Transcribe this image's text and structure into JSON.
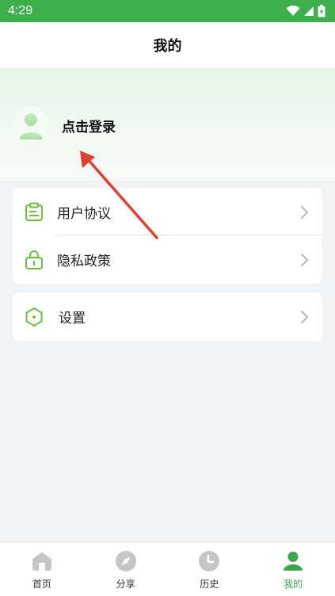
{
  "status_bar": {
    "time": "4:29"
  },
  "header": {
    "title": "我的"
  },
  "profile": {
    "login_label": "点击登录"
  },
  "menu_group_1": [
    {
      "label": "用户协议",
      "icon": "clipboard-icon"
    },
    {
      "label": "隐私政策",
      "icon": "lock-icon"
    }
  ],
  "menu_group_2": [
    {
      "label": "设置",
      "icon": "settings-hexagon-icon"
    }
  ],
  "tab_bar": {
    "tabs": [
      {
        "label": "首页",
        "icon": "home-icon"
      },
      {
        "label": "分享",
        "icon": "compass-icon"
      },
      {
        "label": "历史",
        "icon": "clock-icon"
      },
      {
        "label": "我的",
        "icon": "profile-icon"
      }
    ],
    "active_index": 3
  },
  "colors": {
    "brand_green": "#3cae4c",
    "tab_active": "#3aa84a",
    "annotation_arrow": "#e0412f"
  }
}
